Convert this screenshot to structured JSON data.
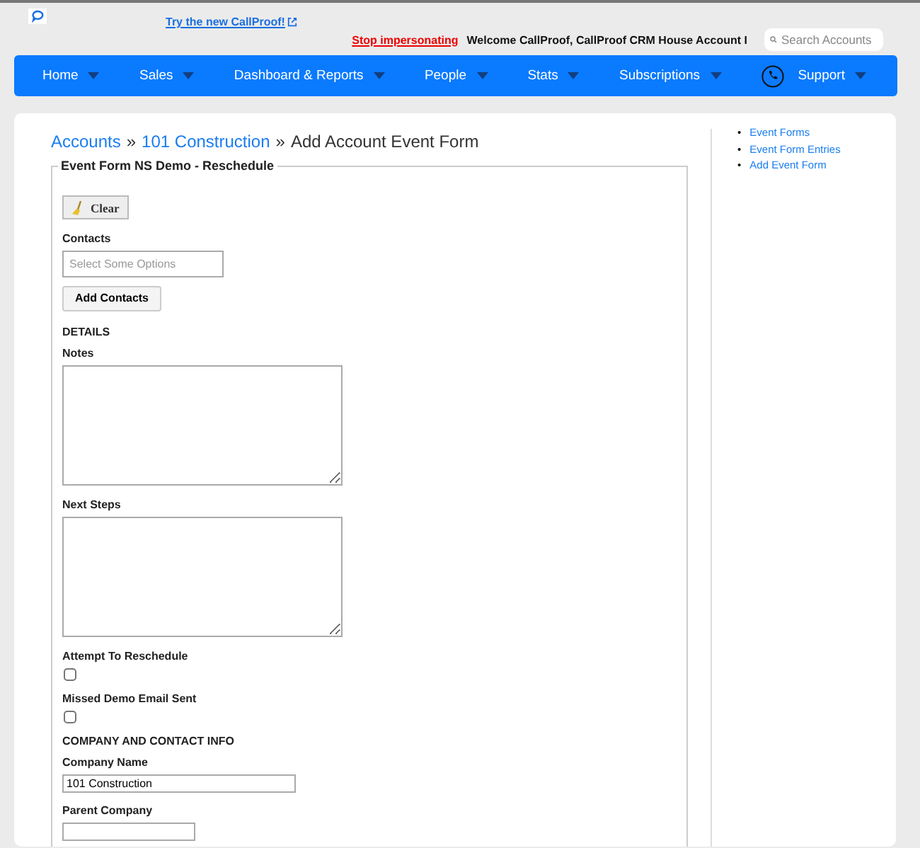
{
  "header": {
    "try_link": "Try the new CallProof!",
    "stop_link": "Stop impersonating",
    "welcome": "Welcome CallProof, CallProof CRM House Account I",
    "search": {
      "placeholder": "Search Accounts"
    }
  },
  "nav": [
    {
      "label": "Home"
    },
    {
      "label": "Sales"
    },
    {
      "label": "Dashboard & Reports"
    },
    {
      "label": "People"
    },
    {
      "label": "Stats"
    },
    {
      "label": "Subscriptions"
    },
    {
      "label": "Support",
      "phone": true
    }
  ],
  "breadcrumb": {
    "links": [
      "Accounts",
      "101 Construction"
    ],
    "separator": "»",
    "current": "Add Account Event Form"
  },
  "form": {
    "legend": "Event Form NS Demo - Reschedule",
    "clear_button": "Clear",
    "fields": [
      {
        "kind": "label",
        "text": "Contacts"
      },
      {
        "kind": "select",
        "placeholder": "Select Some Options"
      },
      {
        "kind": "button",
        "text": "Add Contacts"
      },
      {
        "kind": "section",
        "text": "DETAILS"
      },
      {
        "kind": "label",
        "text": "Notes"
      },
      {
        "kind": "textarea"
      },
      {
        "kind": "label",
        "text": "Next Steps"
      },
      {
        "kind": "textarea"
      },
      {
        "kind": "label",
        "text": "Attempt To Reschedule"
      },
      {
        "kind": "checkbox",
        "checked": false
      },
      {
        "kind": "label",
        "text": "Missed Demo Email Sent"
      },
      {
        "kind": "checkbox",
        "checked": false
      },
      {
        "kind": "section",
        "text": "COMPANY AND CONTACT INFO"
      },
      {
        "kind": "label",
        "text": "Company Name"
      },
      {
        "kind": "text",
        "value": "101 Construction"
      },
      {
        "kind": "label",
        "text": "Parent Company"
      },
      {
        "kind": "short"
      }
    ]
  },
  "sidebar": {
    "bullet": "•",
    "links": [
      "Event Forms",
      "Event Form Entries",
      "Add Event Form"
    ]
  }
}
